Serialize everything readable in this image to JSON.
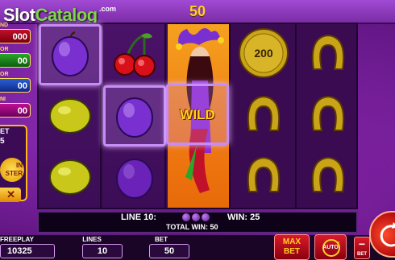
{
  "logo": {
    "slot": "Slot",
    "catalog": "Catalog",
    "com": ".com"
  },
  "top_bar": {
    "value": "50"
  },
  "jackpots": [
    {
      "name": "grand",
      "tab": "ND",
      "value": "000"
    },
    {
      "name": "major",
      "tab": "OR",
      "value": "00"
    },
    {
      "name": "minor",
      "tab": "OR",
      "value": "00"
    },
    {
      "name": "mini",
      "tab": "NI",
      "value": "00"
    }
  ],
  "side_panel": {
    "bet_label": "ET",
    "bet_value": "5",
    "spin_master": "IN\nSTER",
    "close": "✕"
  },
  "reels": [
    [
      "plum",
      "lemon",
      "lemon"
    ],
    [
      "cherry",
      "plum",
      "plum"
    ],
    [
      "joker",
      "wild",
      "joker"
    ],
    [
      "coin",
      "horseshoe",
      "horseshoe"
    ],
    [
      "horseshoe",
      "horseshoe",
      "horseshoe"
    ]
  ],
  "wild_label": "WILD",
  "coin_value": "200",
  "info": {
    "line_label": "LINE 10:",
    "win_label": "WIN: 25",
    "total_win": "TOTAL WIN: 50"
  },
  "bottom": {
    "freeplay_label": "FREEPLAY",
    "freeplay_value": "10325",
    "lines_label": "LINES",
    "lines_value": "10",
    "bet_label": "BET",
    "bet_value": "50",
    "maxbet_label": "MAX\nBET",
    "auto_label": "AUTO",
    "minus_label": "−",
    "minus_bet": "BET"
  },
  "colors": {
    "accent": "#ffd21f",
    "reel_bg": "#3c0d57",
    "wild_reel": "#f07b12",
    "highlight": "#c78cf5"
  }
}
